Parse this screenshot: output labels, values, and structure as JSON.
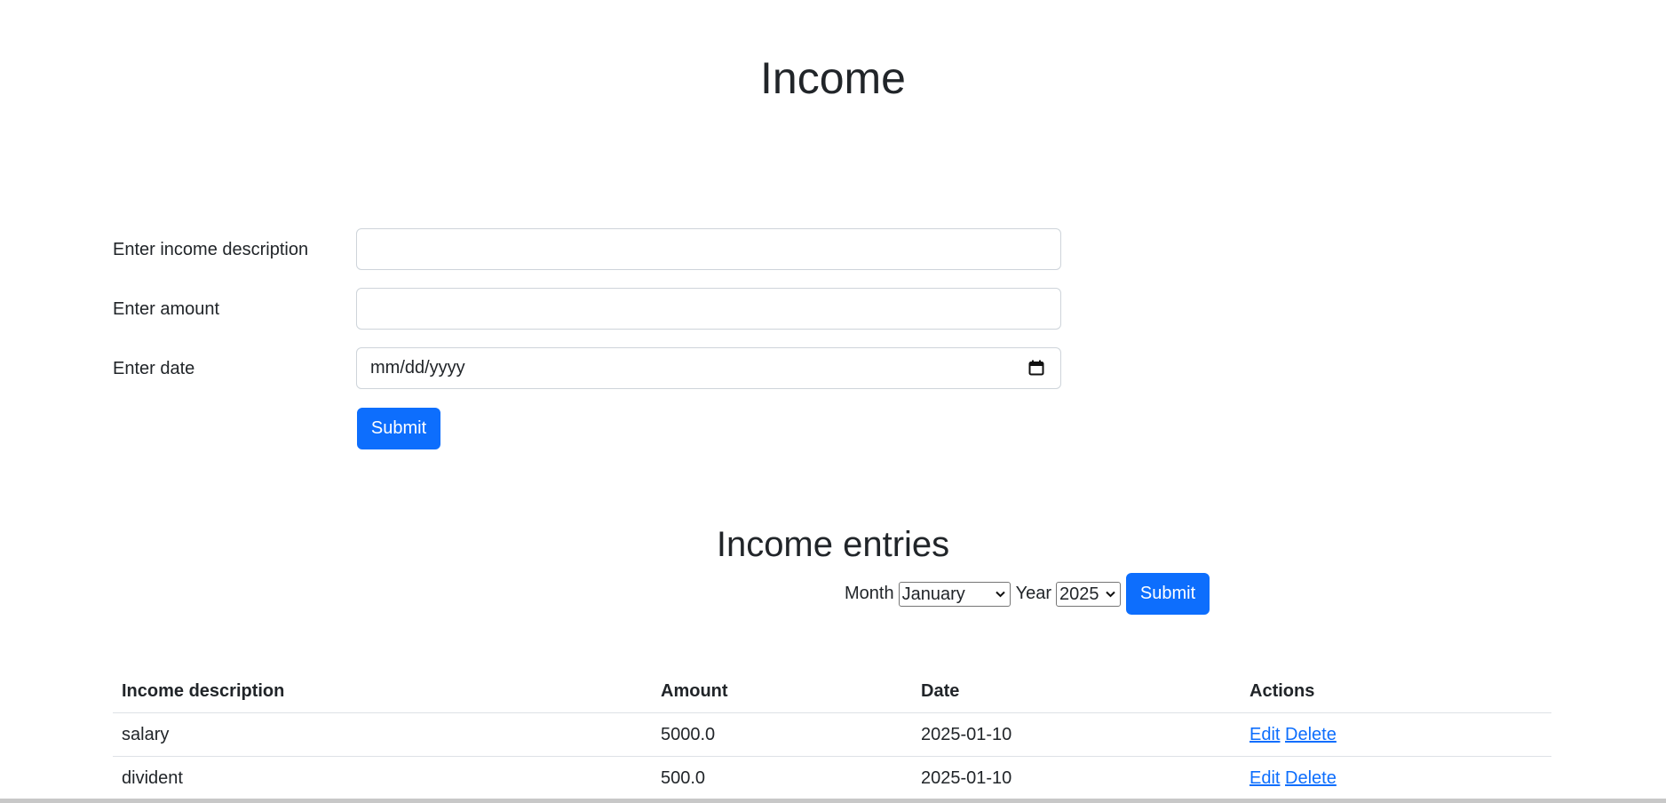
{
  "page": {
    "title": "Income"
  },
  "form": {
    "description_label": "Enter income description",
    "description_value": "",
    "amount_label": "Enter amount",
    "amount_value": "",
    "date_label": "Enter date",
    "date_placeholder": "mm/dd/yyyy",
    "submit_label": "Submit"
  },
  "entries": {
    "title": "Income entries",
    "filter": {
      "month_label": "Month",
      "month_selected": "January",
      "year_label": "Year",
      "year_selected": "2025",
      "submit_label": "Submit"
    },
    "columns": [
      "Income description",
      "Amount",
      "Date",
      "Actions"
    ],
    "rows": [
      {
        "description": "salary",
        "amount": "5000.0",
        "date": "2025-01-10",
        "edit": "Edit",
        "delete": "Delete"
      },
      {
        "description": "divident",
        "amount": "500.0",
        "date": "2025-01-10",
        "edit": "Edit",
        "delete": "Delete"
      }
    ]
  },
  "colors": {
    "primary": "#0d6efd",
    "text": "#212529",
    "border": "#dee2e6"
  }
}
